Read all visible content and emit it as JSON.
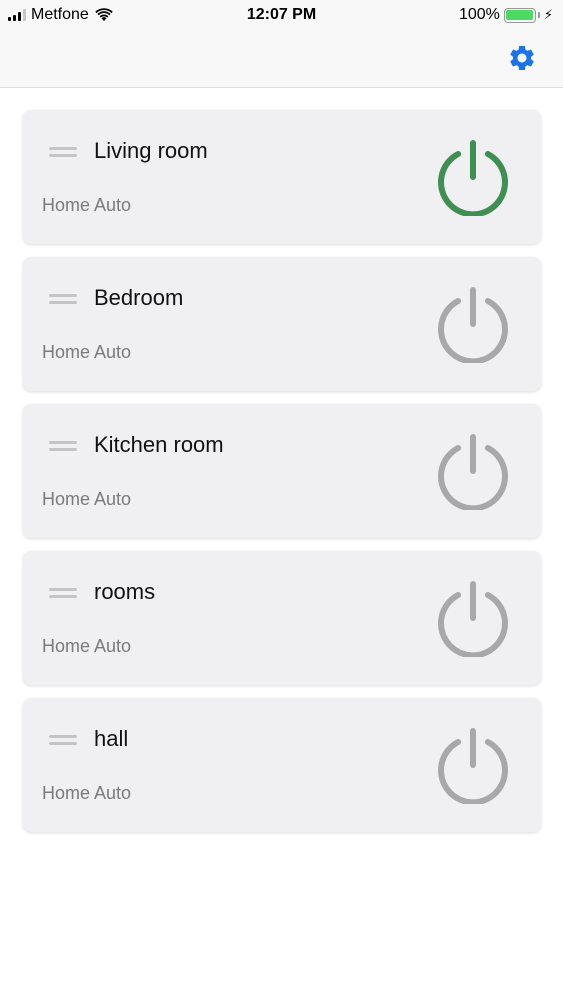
{
  "status_bar": {
    "carrier": "Metfone",
    "time": "12:07 PM",
    "battery": "100%"
  },
  "nav": {
    "settings_icon": "gear-icon",
    "accent_color": "#1a73e8"
  },
  "rooms": [
    {
      "name": "Living room",
      "subtitle": "Home Auto",
      "on": true
    },
    {
      "name": "Bedroom",
      "subtitle": "Home Auto",
      "on": false
    },
    {
      "name": "Kitchen room",
      "subtitle": "Home Auto",
      "on": false
    },
    {
      "name": "rooms",
      "subtitle": "Home Auto",
      "on": false
    },
    {
      "name": "hall",
      "subtitle": "Home Auto",
      "on": false
    }
  ],
  "colors": {
    "power_on": "#3f8f52",
    "power_off": "#a8a8a8"
  }
}
